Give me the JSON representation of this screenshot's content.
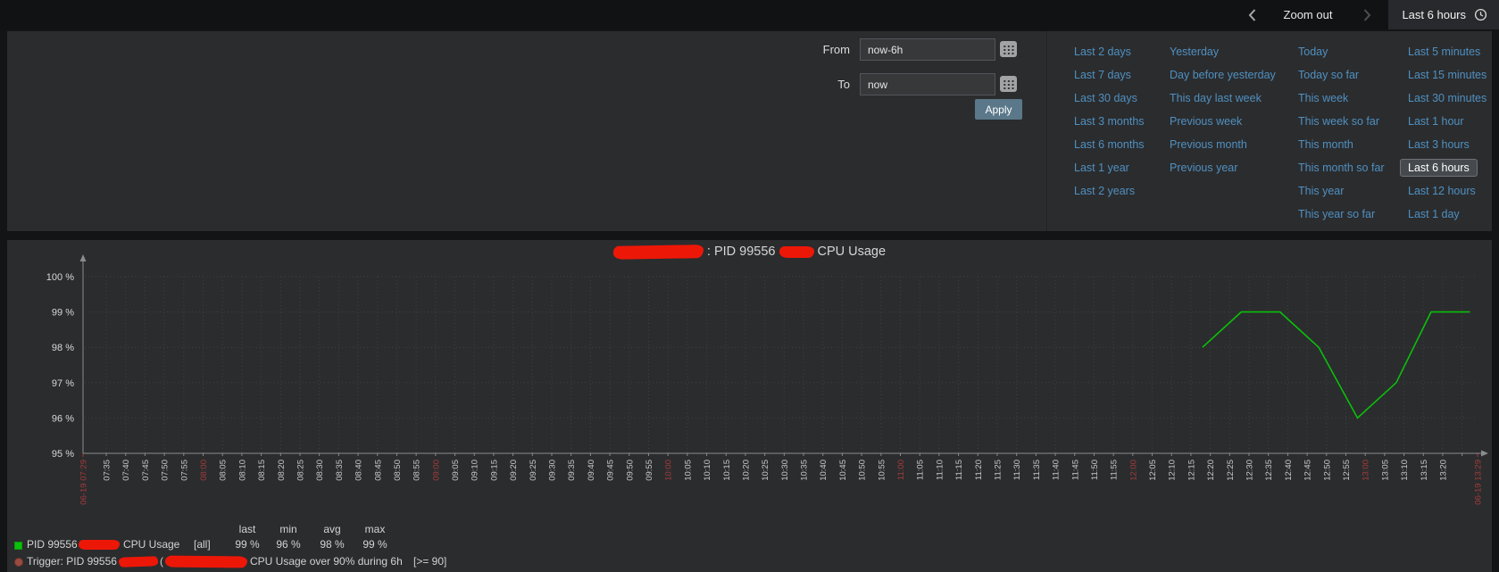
{
  "topbar": {
    "zoom_out_label": "Zoom out",
    "time_range_button": "Last 6 hours"
  },
  "time_filter": {
    "from_label": "From",
    "from_value": "now-6h",
    "to_label": "To",
    "to_value": "now",
    "apply_label": "Apply",
    "selected_range": "Last 6 hours",
    "quick_ranges_columns": [
      [
        "Last 2 days",
        "Last 7 days",
        "Last 30 days",
        "Last 3 months",
        "Last 6 months",
        "Last 1 year",
        "Last 2 years"
      ],
      [
        "Yesterday",
        "Day before yesterday",
        "This day last week",
        "Previous week",
        "Previous month",
        "Previous year"
      ],
      [
        "Today",
        "Today so far",
        "This week",
        "This week so far",
        "This month",
        "This month so far",
        "This year",
        "This year so far"
      ],
      [
        "Last 5 minutes",
        "Last 15 minutes",
        "Last 30 minutes",
        "Last 1 hour",
        "Last 3 hours",
        "Last 6 hours",
        "Last 12 hours",
        "Last 1 day"
      ]
    ]
  },
  "chart_data": {
    "type": "line",
    "title_parts": {
      "mid": ": PID 99556",
      "suffix": "CPU Usage"
    },
    "ylabel_ticks": [
      "100 %",
      "99 %",
      "98 %",
      "97 %",
      "96 %",
      "95 %"
    ],
    "ylim": [
      95,
      100
    ],
    "grid": true,
    "legend_position": "bottom",
    "x_axis": {
      "start_label": "06-19 07:29",
      "end_label": "06-19 13:29",
      "tick_interval_minutes": 5,
      "tick_labels": [
        "07:35",
        "07:40",
        "07:45",
        "07:50",
        "07:55",
        "08:00",
        "08:05",
        "08:10",
        "08:15",
        "08:20",
        "08:25",
        "08:30",
        "08:35",
        "08:40",
        "08:45",
        "08:50",
        "08:55",
        "09:00",
        "09:05",
        "09:10",
        "09:15",
        "09:20",
        "09:25",
        "09:30",
        "09:35",
        "09:40",
        "09:45",
        "09:50",
        "09:55",
        "10:00",
        "10:05",
        "10:10",
        "10:15",
        "10:20",
        "10:25",
        "10:30",
        "10:35",
        "10:40",
        "10:45",
        "10:50",
        "10:55",
        "11:00",
        "11:05",
        "11:10",
        "11:15",
        "11:20",
        "11:25",
        "11:30",
        "11:35",
        "11:40",
        "11:45",
        "11:50",
        "11:55",
        "12:00",
        "12:05",
        "12:10",
        "12:15",
        "12:20",
        "12:25",
        "12:30",
        "12:35",
        "12:40",
        "12:45",
        "12:50",
        "12:55",
        "13:00",
        "13:05",
        "13:10",
        "13:15",
        "13:20"
      ]
    },
    "series": [
      {
        "name": "PID 99556 CPU Usage",
        "color": "#0ac00a",
        "points": [
          {
            "time": "12:18",
            "value": 98
          },
          {
            "time": "12:28",
            "value": 99
          },
          {
            "time": "12:38",
            "value": 99
          },
          {
            "time": "12:48",
            "value": 98
          },
          {
            "time": "12:58",
            "value": 96
          },
          {
            "time": "13:08",
            "value": 97
          },
          {
            "time": "13:17",
            "value": 99
          },
          {
            "time": "13:27",
            "value": 99
          }
        ]
      }
    ],
    "legend": {
      "header": [
        "last",
        "min",
        "avg",
        "max"
      ],
      "series_row": {
        "label_prefix": "PID 99556",
        "label_suffix": "CPU Usage",
        "scope": "[all]",
        "last": "99 %",
        "min": "96 %",
        "avg": "98 %",
        "max": "99 %"
      },
      "trigger_row": {
        "prefix": "Trigger: PID 99556",
        "open_paren": "(",
        "suffix": "CPU Usage over 90% during 6h",
        "condition": "[>= 90]"
      }
    }
  },
  "colors": {
    "link_blue": "#4f90c0",
    "line_green": "#0ac00a",
    "axis_red": "#a23c3c",
    "redaction_red": "#ed1708",
    "apply_button": "#5a7889",
    "panel_bg": "#2b2c2e"
  }
}
